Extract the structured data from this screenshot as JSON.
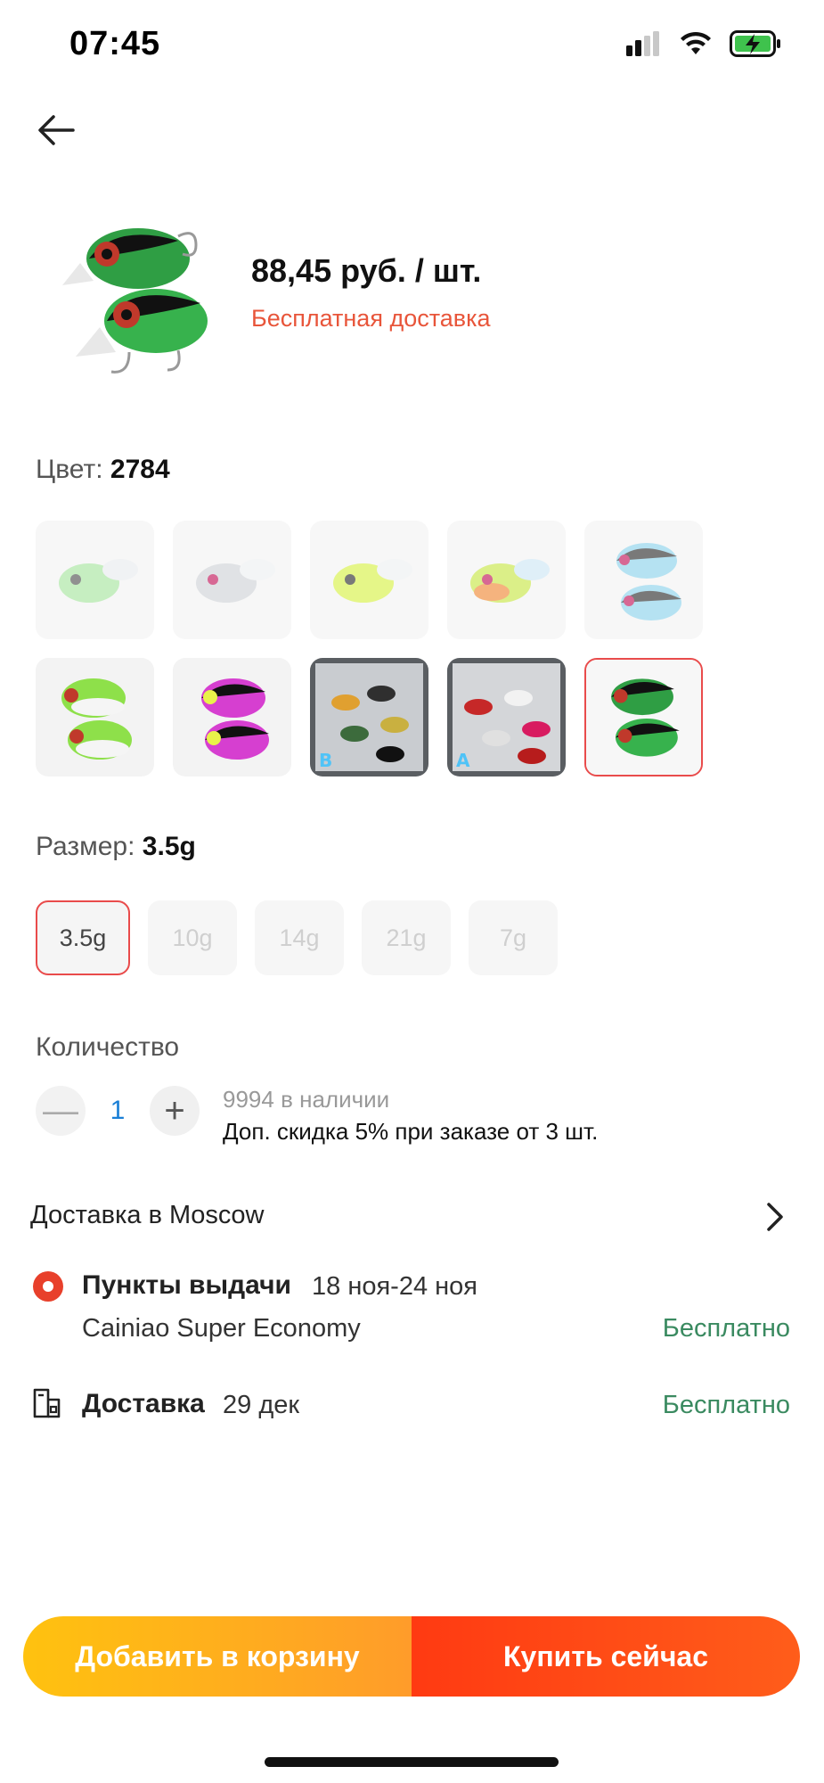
{
  "status_bar": {
    "time": "07:45",
    "icons": [
      "cellular-signal-icon",
      "wifi-icon",
      "battery-charging-icon"
    ],
    "battery_color": "#3fc24d"
  },
  "header": {
    "back_icon": "arrow-left-icon"
  },
  "product": {
    "price": "88,45 руб. / шт.",
    "shipping": "Бесплатная доставка"
  },
  "color": {
    "label": "Цвет:",
    "selected": "2784",
    "swatches": [
      {
        "name": "green-lure",
        "selected": false
      },
      {
        "name": "silver-lure",
        "selected": false
      },
      {
        "name": "yellow-lure",
        "selected": false
      },
      {
        "name": "yellow-orange-lure",
        "selected": false
      },
      {
        "name": "blue-lures",
        "selected": false
      },
      {
        "name": "green-white-lures",
        "selected": false
      },
      {
        "name": "pink-lures",
        "selected": false
      },
      {
        "name": "set-b",
        "selected": false
      },
      {
        "name": "set-a",
        "selected": false
      },
      {
        "name": "black-green-lures",
        "selected": true
      }
    ]
  },
  "size": {
    "label": "Размер:",
    "selected": "3.5g",
    "options": [
      "3.5g",
      "10g",
      "14g",
      "21g",
      "7g"
    ]
  },
  "quantity": {
    "label": "Количество",
    "value": "1",
    "minus": "—",
    "plus": "+",
    "stock": "9994 в наличии",
    "discount": "Доп. скидка 5% при заказе от 3 шт."
  },
  "delivery": {
    "header": "Доставка в Moscow",
    "pickup": {
      "title": "Пункты выдачи",
      "date": "18 ноя-24 ноя",
      "carrier": "Cainiao Super Economy",
      "price": "Бесплатно"
    },
    "courier": {
      "title": "Доставка",
      "date": "29 дек",
      "price": "Бесплатно"
    }
  },
  "actions": {
    "add_to_cart": "Добавить в корзину",
    "buy_now": "Купить сейчас"
  },
  "colors": {
    "accent_red": "#e94b4b",
    "shipping_red": "#e8553a",
    "free_green": "#3a8a60",
    "cart_orange": "#ffb51a",
    "buy_red": "#ff4416"
  }
}
